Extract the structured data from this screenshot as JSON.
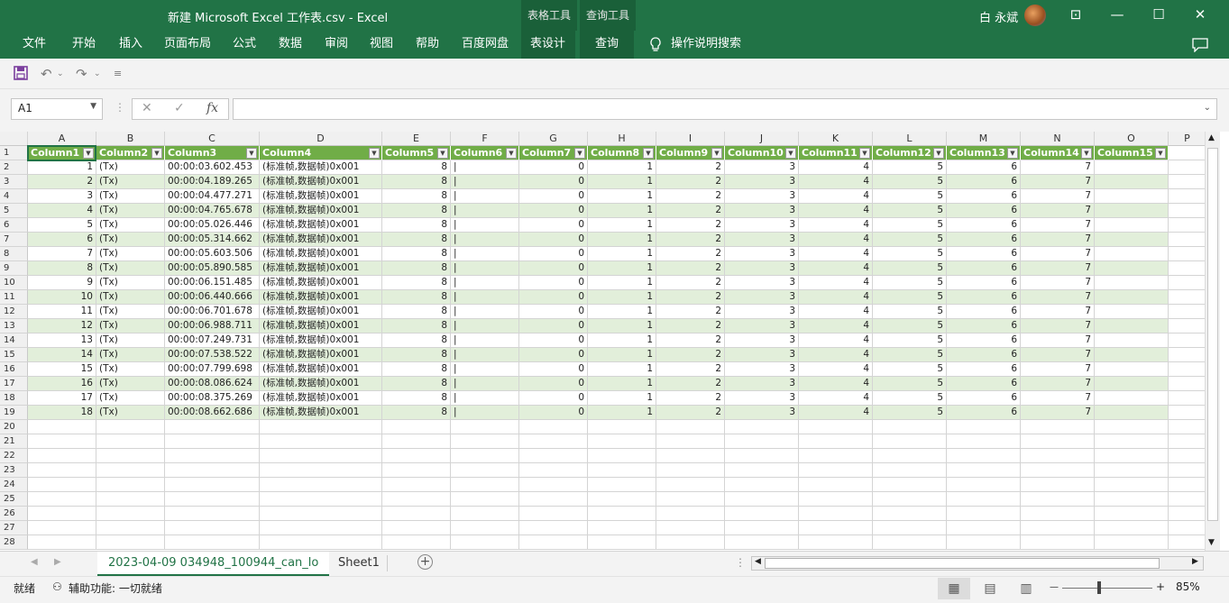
{
  "window": {
    "title": "新建 Microsoft Excel 工作表.csv  -  Excel",
    "ctx_tab_table": "表格工具",
    "ctx_tab_query": "查询工具",
    "user": "白 永斌",
    "minimize": "—",
    "maximize": "☐",
    "close": "✕",
    "ribbon_display": "⊡"
  },
  "menu": {
    "items": [
      "文件",
      "开始",
      "插入",
      "页面布局",
      "公式",
      "数据",
      "审阅",
      "视图",
      "帮助",
      "百度网盘",
      "表设计",
      "查询"
    ],
    "tell_me": "操作说明搜索"
  },
  "formula_bar": {
    "name_box": "A1",
    "cancel": "✕",
    "confirm": "✓",
    "fx": "fx",
    "value": ""
  },
  "sheet": {
    "col_letters": [
      "A",
      "B",
      "C",
      "D",
      "E",
      "F",
      "G",
      "H",
      "I",
      "J",
      "K",
      "L",
      "M",
      "N",
      "O",
      "P"
    ],
    "headers": [
      "Column1",
      "Column2",
      "Column3",
      "Column4",
      "Column5",
      "Column6",
      "Column7",
      "Column8",
      "Column9",
      "Column10",
      "Column11",
      "Column12",
      "Column13",
      "Column14",
      "Column15"
    ],
    "row_numbers": [
      "1",
      "2",
      "3",
      "4",
      "5",
      "6",
      "7",
      "8",
      "9",
      "10",
      "11",
      "12",
      "13",
      "14",
      "15",
      "16",
      "17",
      "18",
      "19",
      "20",
      "21",
      "22",
      "23",
      "24",
      "25",
      "26",
      "27",
      "28"
    ],
    "rows": [
      [
        "1",
        "(Tx)",
        "00:00:03.602.453",
        "(标准帧,数据帧)0x001",
        "8",
        "|",
        "0",
        "1",
        "2",
        "3",
        "4",
        "5",
        "6",
        "7",
        ""
      ],
      [
        "2",
        "(Tx)",
        "00:00:04.189.265",
        "(标准帧,数据帧)0x001",
        "8",
        "|",
        "0",
        "1",
        "2",
        "3",
        "4",
        "5",
        "6",
        "7",
        ""
      ],
      [
        "3",
        "(Tx)",
        "00:00:04.477.271",
        "(标准帧,数据帧)0x001",
        "8",
        "|",
        "0",
        "1",
        "2",
        "3",
        "4",
        "5",
        "6",
        "7",
        ""
      ],
      [
        "4",
        "(Tx)",
        "00:00:04.765.678",
        "(标准帧,数据帧)0x001",
        "8",
        "|",
        "0",
        "1",
        "2",
        "3",
        "4",
        "5",
        "6",
        "7",
        ""
      ],
      [
        "5",
        "(Tx)",
        "00:00:05.026.446",
        "(标准帧,数据帧)0x001",
        "8",
        "|",
        "0",
        "1",
        "2",
        "3",
        "4",
        "5",
        "6",
        "7",
        ""
      ],
      [
        "6",
        "(Tx)",
        "00:00:05.314.662",
        "(标准帧,数据帧)0x001",
        "8",
        "|",
        "0",
        "1",
        "2",
        "3",
        "4",
        "5",
        "6",
        "7",
        ""
      ],
      [
        "7",
        "(Tx)",
        "00:00:05.603.506",
        "(标准帧,数据帧)0x001",
        "8",
        "|",
        "0",
        "1",
        "2",
        "3",
        "4",
        "5",
        "6",
        "7",
        ""
      ],
      [
        "8",
        "(Tx)",
        "00:00:05.890.585",
        "(标准帧,数据帧)0x001",
        "8",
        "|",
        "0",
        "1",
        "2",
        "3",
        "4",
        "5",
        "6",
        "7",
        ""
      ],
      [
        "9",
        "(Tx)",
        "00:00:06.151.485",
        "(标准帧,数据帧)0x001",
        "8",
        "|",
        "0",
        "1",
        "2",
        "3",
        "4",
        "5",
        "6",
        "7",
        ""
      ],
      [
        "10",
        "(Tx)",
        "00:00:06.440.666",
        "(标准帧,数据帧)0x001",
        "8",
        "|",
        "0",
        "1",
        "2",
        "3",
        "4",
        "5",
        "6",
        "7",
        ""
      ],
      [
        "11",
        "(Tx)",
        "00:00:06.701.678",
        "(标准帧,数据帧)0x001",
        "8",
        "|",
        "0",
        "1",
        "2",
        "3",
        "4",
        "5",
        "6",
        "7",
        ""
      ],
      [
        "12",
        "(Tx)",
        "00:00:06.988.711",
        "(标准帧,数据帧)0x001",
        "8",
        "|",
        "0",
        "1",
        "2",
        "3",
        "4",
        "5",
        "6",
        "7",
        ""
      ],
      [
        "13",
        "(Tx)",
        "00:00:07.249.731",
        "(标准帧,数据帧)0x001",
        "8",
        "|",
        "0",
        "1",
        "2",
        "3",
        "4",
        "5",
        "6",
        "7",
        ""
      ],
      [
        "14",
        "(Tx)",
        "00:00:07.538.522",
        "(标准帧,数据帧)0x001",
        "8",
        "|",
        "0",
        "1",
        "2",
        "3",
        "4",
        "5",
        "6",
        "7",
        ""
      ],
      [
        "15",
        "(Tx)",
        "00:00:07.799.698",
        "(标准帧,数据帧)0x001",
        "8",
        "|",
        "0",
        "1",
        "2",
        "3",
        "4",
        "5",
        "6",
        "7",
        ""
      ],
      [
        "16",
        "(Tx)",
        "00:00:08.086.624",
        "(标准帧,数据帧)0x001",
        "8",
        "|",
        "0",
        "1",
        "2",
        "3",
        "4",
        "5",
        "6",
        "7",
        ""
      ],
      [
        "17",
        "(Tx)",
        "00:00:08.375.269",
        "(标准帧,数据帧)0x001",
        "8",
        "|",
        "0",
        "1",
        "2",
        "3",
        "4",
        "5",
        "6",
        "7",
        ""
      ],
      [
        "18",
        "(Tx)",
        "00:00:08.662.686",
        "(标准帧,数据帧)0x001",
        "8",
        "|",
        "0",
        "1",
        "2",
        "3",
        "4",
        "5",
        "6",
        "7",
        ""
      ]
    ]
  },
  "sheet_tabs": {
    "active": "2023-04-09 034948_100944_can_lo",
    "other": "Sheet1",
    "add": "+"
  },
  "status": {
    "ready": "就绪",
    "accessibility": "辅助功能: 一切就绪",
    "zoom": "85%",
    "zoom_minus": "—",
    "zoom_plus": "+"
  },
  "colors": {
    "accent": "#217346",
    "table_header": "#70ad47",
    "band": "#e2efda"
  }
}
